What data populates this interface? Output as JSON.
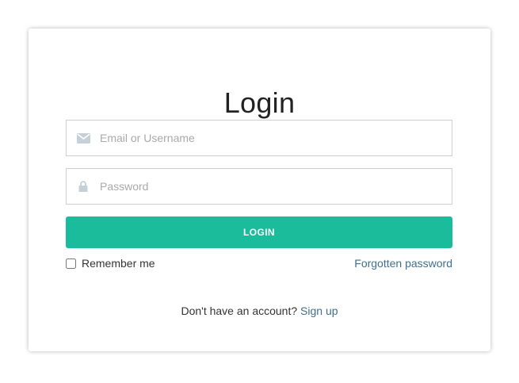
{
  "form": {
    "title": "Login",
    "email_placeholder": "Email or Username",
    "password_placeholder": "Password",
    "login_label": "LOGIN",
    "remember_label": "Remember me",
    "remember_checked": false,
    "forgot_label": "Forgotten password",
    "signup_prompt": "Don't have an account?",
    "signup_label": "Sign up"
  },
  "colors": {
    "accent": "#1abc9c",
    "link": "#3f6f8c",
    "icon": "#c5d0d8",
    "field_border": "#cfcfcf"
  },
  "icons": {
    "email": "envelope-icon",
    "password": "lock-icon"
  }
}
